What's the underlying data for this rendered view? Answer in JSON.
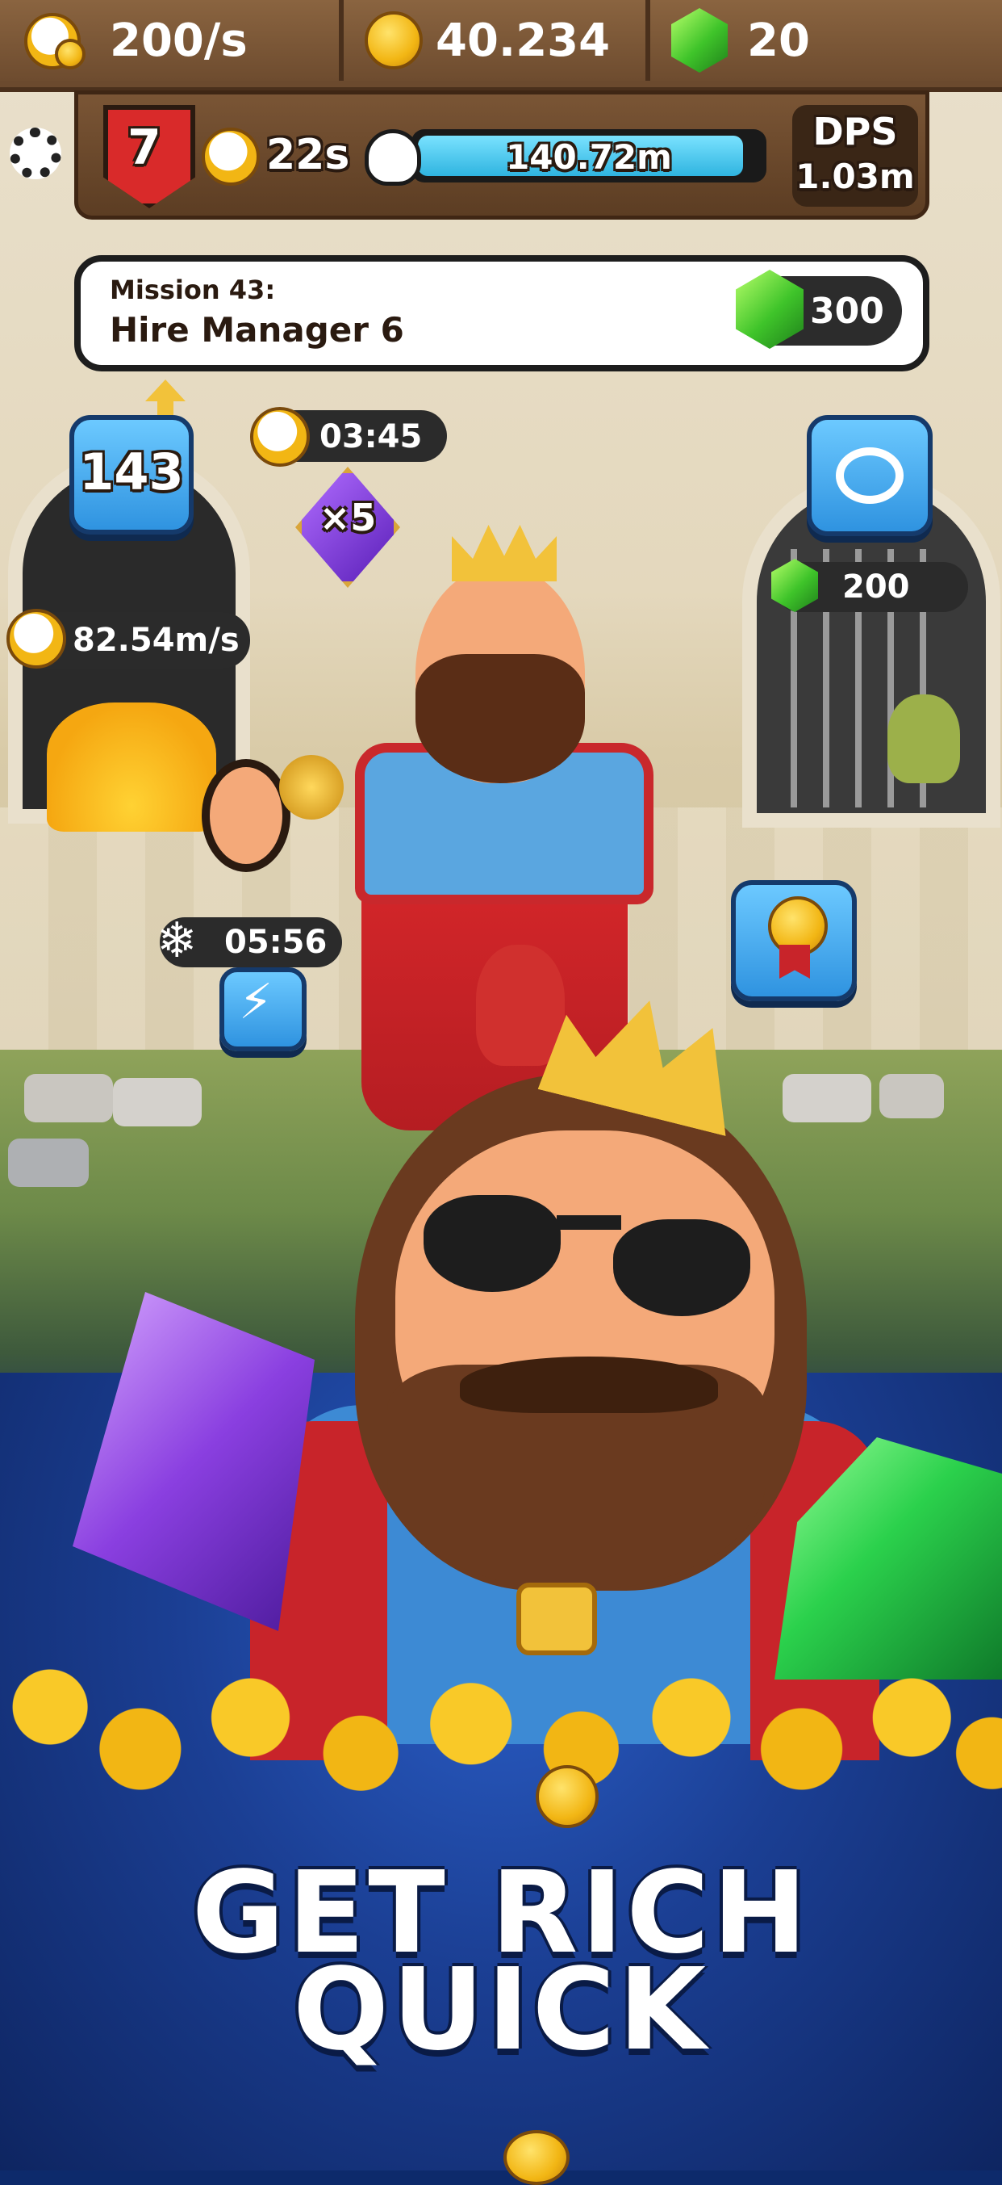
{
  "currency_bar": {
    "income_rate": "200/s",
    "coins": "40.234",
    "gems": "20"
  },
  "stats": {
    "level": "7",
    "timer": "22s",
    "boss_hp": "140.72m",
    "boss_hp_fraction": 0.95,
    "dps_label": "DPS",
    "dps_value": "1.03m"
  },
  "mission": {
    "title": "Mission 43:",
    "task": "Hire Manager 6",
    "reward": "300"
  },
  "upgrade": {
    "level": "143"
  },
  "boost": {
    "timer": "03:45",
    "multiplier": "×5"
  },
  "vault": {
    "rate": "82.54m/s"
  },
  "jail": {
    "cost": "200"
  },
  "freeze": {
    "timer": "05:56"
  },
  "headline": {
    "line1": "GET RICH",
    "line2": "QUICK"
  },
  "colors": {
    "accent_blue": "#2f93e0",
    "gem_green": "#3fc42a",
    "coin_gold": "#f2b614",
    "level_red": "#d92a2a"
  },
  "icons": [
    "timer-coin-icon",
    "coin-icon",
    "gem-icon",
    "gear-icon",
    "shield-icon",
    "skull-icon",
    "handcuffs-icon",
    "medal-icon",
    "lightning-icon",
    "snowflake-icon",
    "arrow-up-icon"
  ]
}
